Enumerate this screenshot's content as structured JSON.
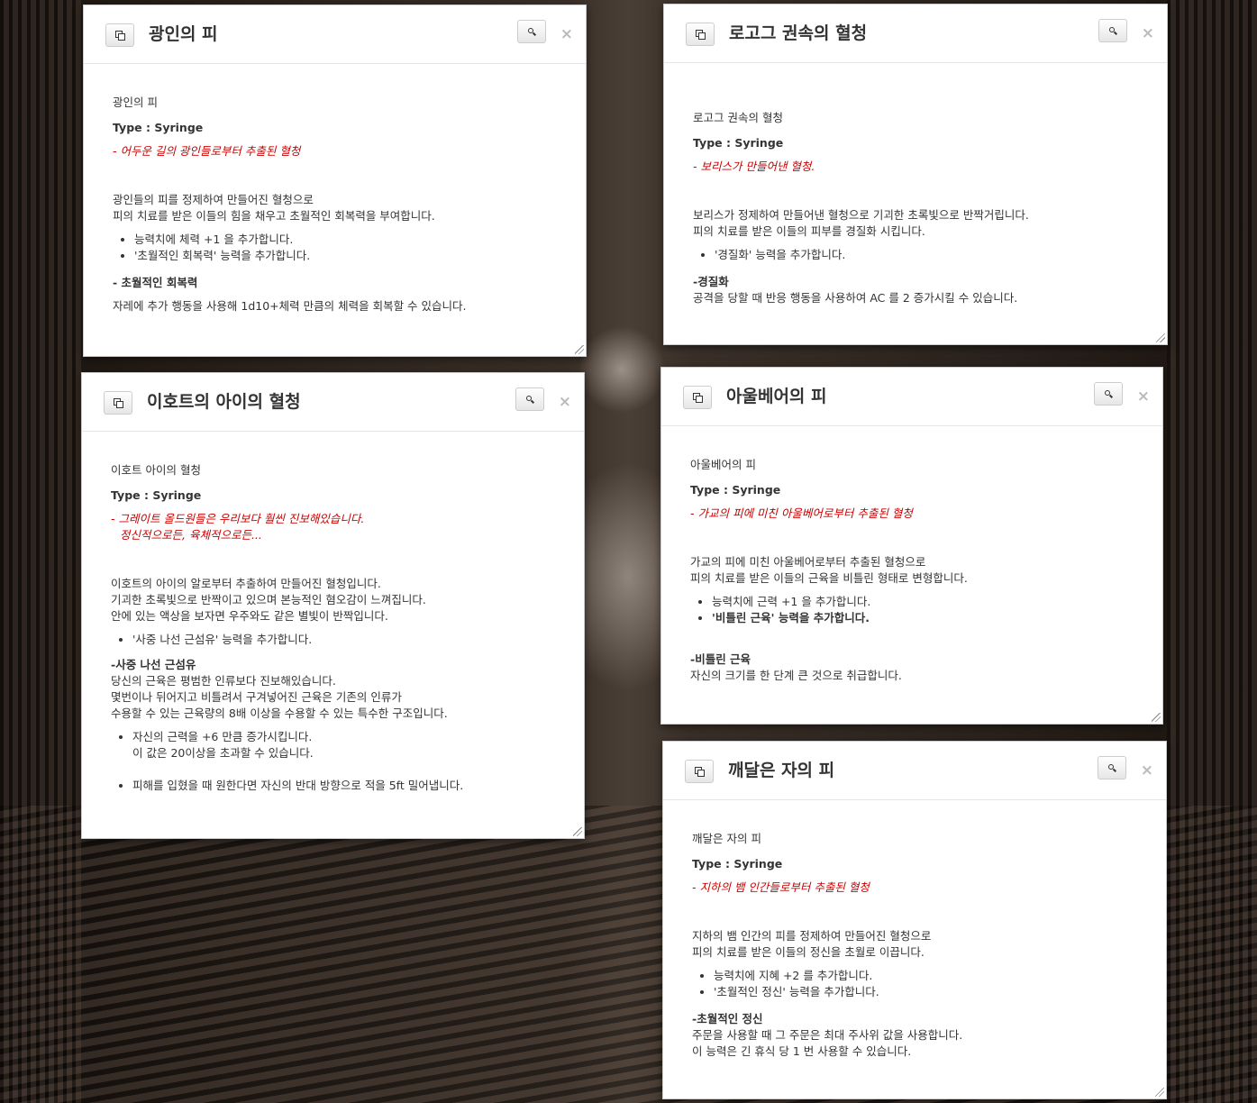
{
  "cards": [
    {
      "title": "광인의 피",
      "name": "광인의 피",
      "type_line": "Type : Syringe",
      "quote": "- 어두운 길의 광인들로부터 추출된 혈청",
      "desc": [
        "광인들의 피를 정제하여 만들어진 혈청으로",
        "피의 치료를 받은 이들의 힘을 채우고 초월적인 회복력을 부여합니다."
      ],
      "bullets": [
        "능력치에 체력 +1 을 추가합니다.",
        "'초월적인 회복력' 능력을 추가합니다."
      ],
      "ability_title": "- 초월적인 회복력",
      "ability_desc": [
        "자레에 추가 행동을 사용해 1d10+체력 만큼의 체력을 회복할 수 있습니다."
      ]
    },
    {
      "title": "로고그 권속의 혈청",
      "name": "로고그 권속의 혈청",
      "type_line": "Type : Syringe",
      "quote": "- 보리스가 만들어낸 혈청.",
      "desc": [
        "보리스가 정제하여 만들어낸 혈청으로 기괴한 초록빛으로 반짝거립니다.",
        "피의 치료를 받은 이들의 피부를 경질화 시킵니다."
      ],
      "bullets": [
        "'경질화' 능력을 추가합니다."
      ],
      "ability_title": "-경질화",
      "ability_desc": [
        "공격을 당할 때 반응 행동을 사용하여 AC 를 2 증가시킬 수 있습니다."
      ]
    },
    {
      "title": "이호트의 아이의 혈청",
      "name": "이호트 아이의 혈청",
      "type_line": "Type : Syringe",
      "quote": "- 그레이트 올드원들은 우리보다 훨씬 진보해있습니다.",
      "quote2": "정신적으로든, 육체적으로든...",
      "desc": [
        "이호트의 아이의 알로부터 추출하여 만들어진 혈청입니다.",
        "기괴한 초록빛으로 반짝이고 있으며 본능적인 혐오감이 느껴집니다.",
        "안에 있는 액상을 보자면 우주와도 같은 별빛이 반짝입니다."
      ],
      "bullets": [
        "'사중 나선 근섬유' 능력을 추가합니다."
      ],
      "ability_title": "-사중 나선 근섬유",
      "ability_desc": [
        "당신의 근육은 평범한 인류보다 진보해있습니다.",
        "몇번이나 뒤어지고 비틀려서 구겨넣어진 근육은 기존의 인류가",
        "수용할 수 있는 근육량의 8배 이상을 수용할 수 있는 특수한 구조입니다."
      ],
      "sub_bullets": [
        "자신의 근력을 +6 만큼 증가시킵니다.",
        "이 값은 20이상을 초과할 수 있습니다.",
        "피해를 입혔을 때 원한다면 자신의 반대 방향으로 적을 5ft 밀어냅니다."
      ]
    },
    {
      "title": "아울베어의 피",
      "name": "아울베어의 피",
      "type_line": "Type : Syringe",
      "quote": "- 가교의 피에 미친 아울베어로부터 추출된 혈청",
      "desc": [
        "가교의 피에 미친 아울베어로부터 추출된 혈청으로",
        "피의 치료를 받은 이들의 근육을 비틀린 형태로 변형합니다."
      ],
      "bullets": [
        "능력치에 근력 +1 을 추가합니다.",
        "'비틀린 근육' 능력을 추가합니다."
      ],
      "ability_title": "-비틀린 근육",
      "ability_desc": [
        "자신의 크기를 한 단계 큰 것으로 취급합니다."
      ]
    },
    {
      "title": "깨달은 자의 피",
      "name": "깨달은 자의 피",
      "type_line": "Type : Syringe",
      "quote": "- 지하의 뱀 인간들로부터 추출된 혈청",
      "desc": [
        "지하의 뱀 인간의 피를 정제하여 만들어진 혈청으로",
        "피의 치료를 받은 이들의 정신을 초월로 이끕니다."
      ],
      "bullets": [
        "능력치에 지혜 +2 를 추가합니다.",
        "'초월적인 정신' 능력을 추가합니다."
      ],
      "ability_title": "-초월적인 정신",
      "ability_desc": [
        "주문을 사용할 때 그 주문은 최대 주사위 값을 사용합니다.",
        "이 능력은 긴 휴식 당 1 번 사용할 수 있습니다."
      ]
    }
  ]
}
